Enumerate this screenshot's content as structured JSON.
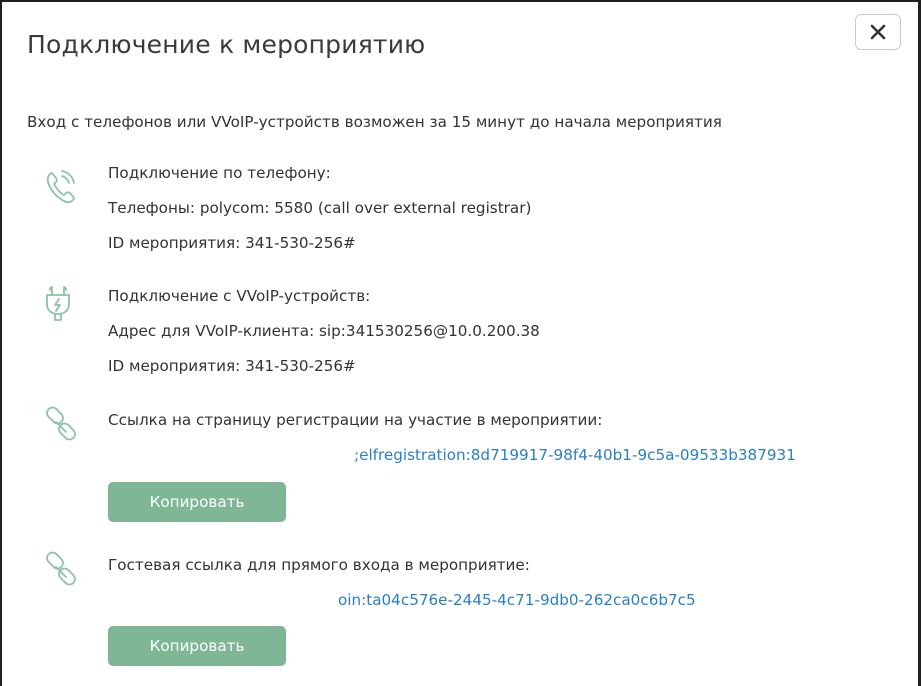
{
  "dialog": {
    "title": "Подключение к мероприятию",
    "close_label": "×",
    "notice": "Вход с телефонов или VVoIP-устройств возможен за 15 минут до начала мероприятия"
  },
  "phone": {
    "icon": "phone-icon",
    "heading": "Подключение по телефону:",
    "phones": "Телефоны: polycom: 5580 (call over external registrar)",
    "event_id": "ID мероприятия: 341-530-256#"
  },
  "voip": {
    "icon": "plug-icon",
    "heading": "Подключение с VVoIP-устройств:",
    "address": "Адрес для VVoIP-клиента: sip:341530256@10.0.200.38",
    "event_id": "ID мероприятия: 341-530-256#"
  },
  "registration": {
    "icon": "link-icon",
    "heading": "Ссылка на страницу регистрации на участие в мероприятии:",
    "link": ";elfregistration:8d719917-98f4-40b1-9c5a-09533b387931",
    "copy_label": "Копировать"
  },
  "guest": {
    "icon": "link-icon",
    "heading": "Гостевая ссылка для прямого входа в мероприятие:",
    "link": "oin:ta04c576e-2445-4c71-9db0-262ca0c6b7c5",
    "copy_label": "Копировать"
  },
  "colors": {
    "accent_green": "#7fb796",
    "link_blue": "#2a7fc4",
    "icon_green": "#8cc3a3"
  }
}
